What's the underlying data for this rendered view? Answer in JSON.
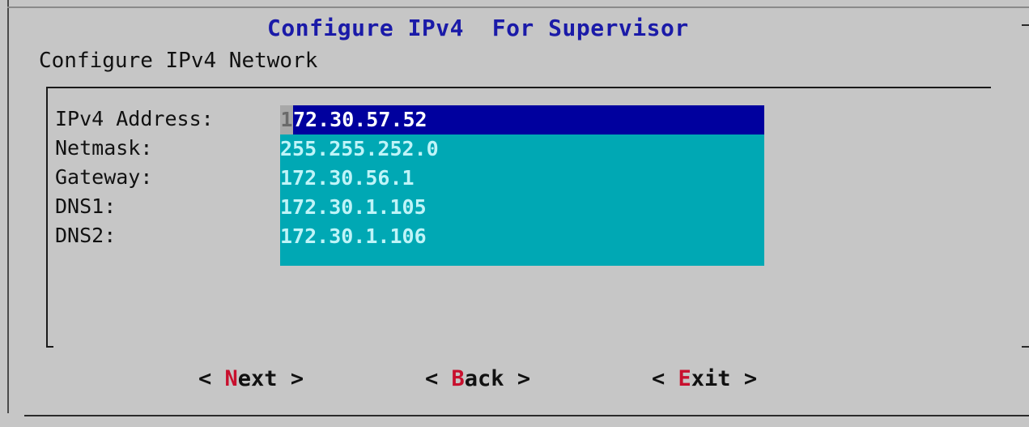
{
  "dialog": {
    "title": "Configure IPv4  For Supervisor",
    "subtitle": "Configure IPv4 Network"
  },
  "fields": [
    {
      "label": "IPv4 Address:",
      "value_first_char": "1",
      "value_rest": "72.30.57.52",
      "active": true
    },
    {
      "label": "Netmask:",
      "value": "255.255.252.0"
    },
    {
      "label": "Gateway:",
      "value": "172.30.56.1"
    },
    {
      "label": "DNS1:",
      "value": "172.30.1.105"
    },
    {
      "label": "DNS2:",
      "value": "172.30.1.106"
    }
  ],
  "buttons": {
    "next": {
      "open": "< ",
      "hotkey": "N",
      "rest": "ext",
      "close": " >"
    },
    "back": {
      "open": "< ",
      "hotkey": "B",
      "rest": "ack",
      "close": " >"
    },
    "exit": {
      "open": "< ",
      "hotkey": "E",
      "rest": "xit",
      "close": " >"
    }
  },
  "colors": {
    "background": "#c6c6c6",
    "title": "#1a1aa8",
    "field_bg": "#00a8b4",
    "active_field_bg": "#00009e",
    "hotkey": "#c8102e"
  }
}
